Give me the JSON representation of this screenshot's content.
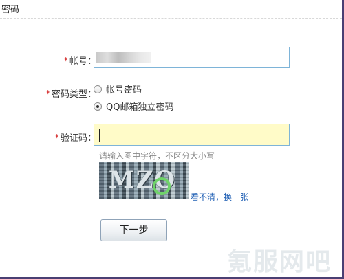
{
  "header": {
    "title": "密码"
  },
  "form": {
    "account": {
      "label": "帐号：",
      "required_mark": "*",
      "value": ""
    },
    "password_type": {
      "label": "密码类型：",
      "required_mark": "*",
      "options": [
        {
          "label": "帐号密码",
          "selected": false
        },
        {
          "label": "QQ邮箱独立密码",
          "selected": true
        }
      ]
    },
    "captcha": {
      "label": "验证码：",
      "required_mark": "*",
      "value": "",
      "hint": "请输入图中字符，不区分大小写",
      "image_text": "MZO",
      "refresh_link": "看不清，换一张"
    },
    "next_button": "下一步"
  },
  "watermark": "氪服网吧",
  "colors": {
    "required": "#d32222",
    "link": "#1f5fb4",
    "captcha_field_bg": "#fffbc8",
    "field_border": "#7eb4d8"
  }
}
